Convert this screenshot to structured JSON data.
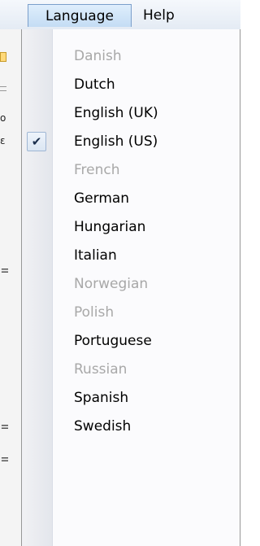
{
  "menubar": {
    "language_label": "Language",
    "help_label": "Help"
  },
  "background_fragments": [
    "o",
    "ε"
  ],
  "language_menu": {
    "items": [
      {
        "label": "Danish",
        "enabled": false,
        "checked": false
      },
      {
        "label": "Dutch",
        "enabled": true,
        "checked": false
      },
      {
        "label": "English (UK)",
        "enabled": true,
        "checked": false
      },
      {
        "label": "English (US)",
        "enabled": true,
        "checked": true
      },
      {
        "label": "French",
        "enabled": false,
        "checked": false
      },
      {
        "label": "German",
        "enabled": true,
        "checked": false
      },
      {
        "label": "Hungarian",
        "enabled": true,
        "checked": false
      },
      {
        "label": "Italian",
        "enabled": true,
        "checked": false
      },
      {
        "label": "Norwegian",
        "enabled": false,
        "checked": false
      },
      {
        "label": "Polish",
        "enabled": false,
        "checked": false
      },
      {
        "label": "Portuguese",
        "enabled": true,
        "checked": false
      },
      {
        "label": "Russian",
        "enabled": false,
        "checked": false
      },
      {
        "label": "Spanish",
        "enabled": true,
        "checked": false
      },
      {
        "label": "Swedish",
        "enabled": true,
        "checked": false
      }
    ],
    "check_glyph": "✔"
  }
}
